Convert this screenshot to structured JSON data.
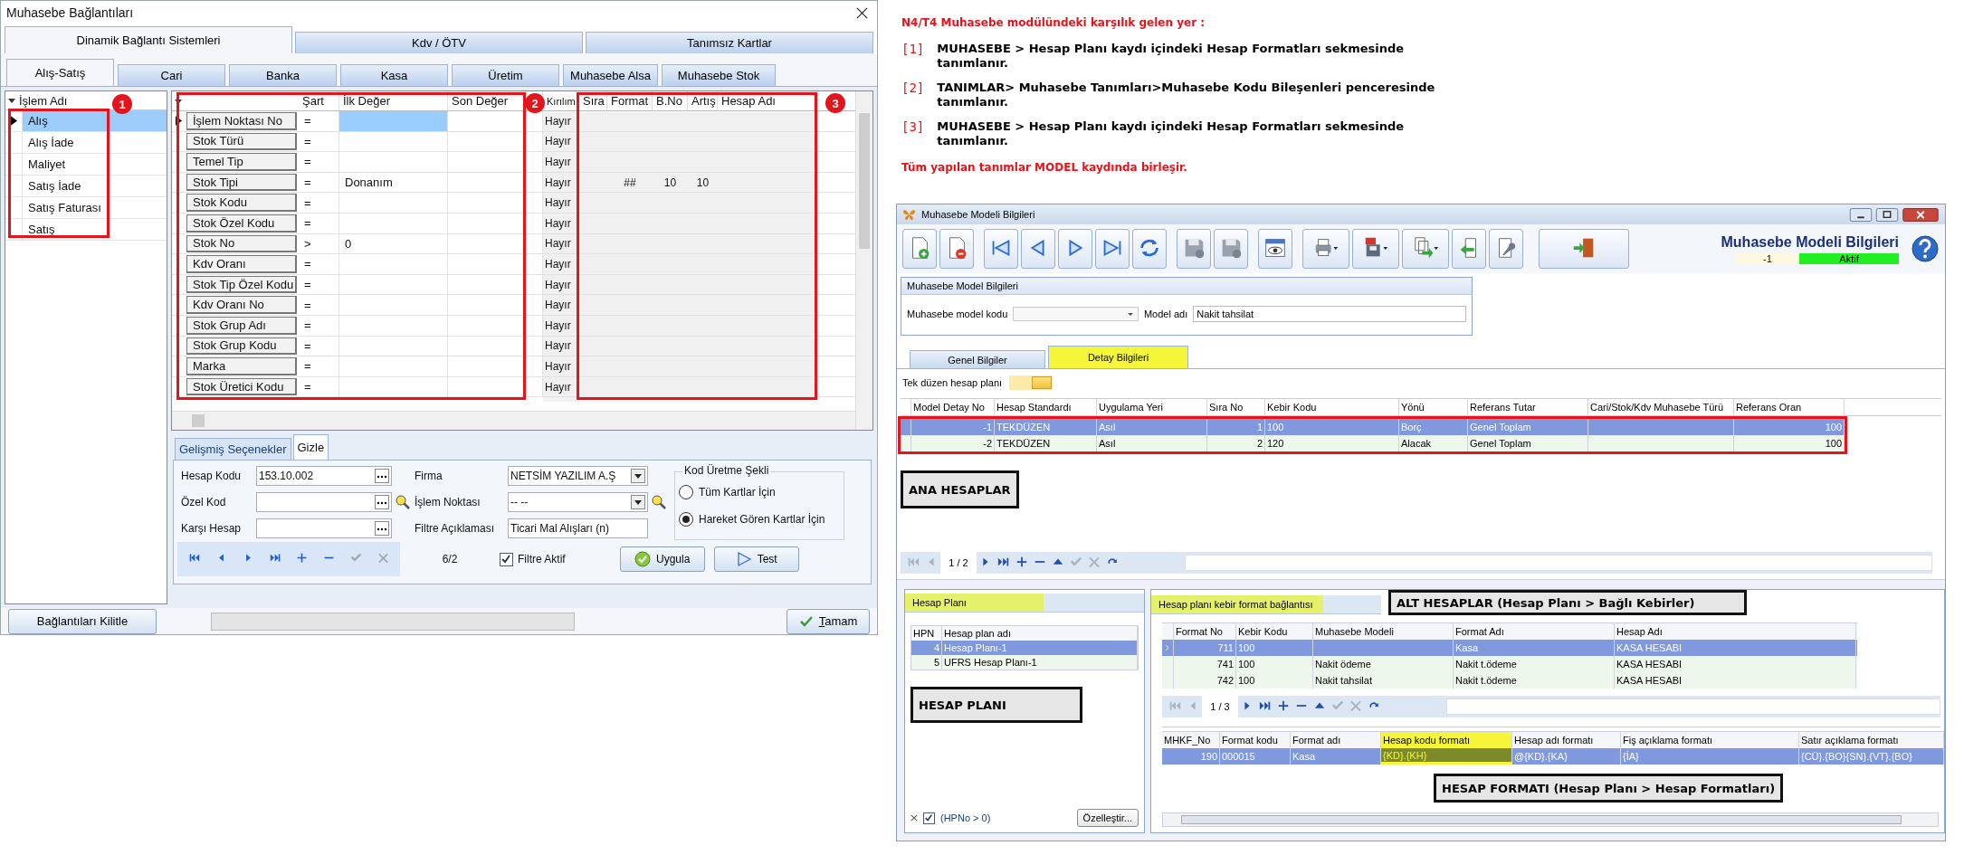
{
  "left_window": {
    "title": "Muhasebe Bağlantıları",
    "top_tabs": [
      {
        "label": "Dinamik Bağlantı Sistemleri",
        "selected": true
      },
      {
        "label": "Kdv / ÖTV",
        "selected": false
      },
      {
        "label": "Tanımsız Kartlar",
        "selected": false
      }
    ],
    "sub_tabs": [
      {
        "label": "Alış-Satış",
        "selected": true
      },
      {
        "label": "Cari",
        "selected": false
      },
      {
        "label": "Banka",
        "selected": false
      },
      {
        "label": "Kasa",
        "selected": false
      },
      {
        "label": "Üretim",
        "selected": false
      },
      {
        "label": "Muhasebe Alsa",
        "selected": false
      },
      {
        "label": "Muhasebe Stok",
        "selected": false
      }
    ],
    "process_list": {
      "header": "İşlem Adı",
      "marker": "1",
      "items": [
        {
          "label": "Alış",
          "selected": true
        },
        {
          "label": "Alış İade",
          "selected": false
        },
        {
          "label": "Maliyet",
          "selected": false
        },
        {
          "label": "Satış İade",
          "selected": false
        },
        {
          "label": "Satış Faturası",
          "selected": false
        },
        {
          "label": "Satış",
          "selected": false
        }
      ]
    },
    "grid": {
      "columns": [
        "Şart",
        "İlk Değer",
        "Son Değer",
        "Kırılım",
        "Sıra",
        "Format",
        "B.No",
        "Artış",
        "Hesap Adı"
      ],
      "markers": [
        "2",
        "3"
      ],
      "rows": [
        {
          "field": "İşlem Noktası No",
          "condition": "=",
          "breakdown": "Hayır",
          "selected": true
        },
        {
          "field": "Stok Türü",
          "condition": "=",
          "breakdown": "Hayır",
          "selected": false
        },
        {
          "field": "Temel Tip",
          "condition": "=",
          "breakdown": "Hayır",
          "selected": false
        },
        {
          "field": "Stok Tipi",
          "condition": "=",
          "start_value": "Donanım",
          "breakdown": "Hayır",
          "format": "##",
          "digit_no": "10",
          "increment": "10",
          "selected": false
        },
        {
          "field": "Stok Kodu",
          "condition": "=",
          "breakdown": "Hayır",
          "selected": false
        },
        {
          "field": "Stok Özel Kodu",
          "condition": "=",
          "breakdown": "Hayır",
          "selected": false
        },
        {
          "field": "Stok No",
          "condition": ">",
          "start_value": "0",
          "breakdown": "Hayır",
          "selected": false
        },
        {
          "field": "Kdv Oranı",
          "condition": "=",
          "breakdown": "Hayır",
          "selected": false
        },
        {
          "field": "Stok Tip Özel Kodu",
          "condition": "=",
          "breakdown": "Hayır",
          "selected": false
        },
        {
          "field": "Kdv Oranı No",
          "condition": "=",
          "breakdown": "Hayır",
          "selected": false
        },
        {
          "field": "Stok Grup Adı",
          "condition": "=",
          "breakdown": "Hayır",
          "selected": false
        },
        {
          "field": "Stok Grup Kodu",
          "condition": "=",
          "breakdown": "Hayır",
          "selected": false
        },
        {
          "field": "Marka",
          "condition": "=",
          "breakdown": "Hayır",
          "selected": false
        },
        {
          "field": "Stok Üretici Kodu",
          "condition": "=",
          "breakdown": "Hayır",
          "selected": false
        }
      ]
    },
    "option_tabs": [
      {
        "label": "Gelişmiş Seçenekler",
        "selected": false
      },
      {
        "label": "Gizle",
        "selected": true
      }
    ],
    "fields_left": [
      {
        "label": "Hesap Kodu",
        "value": "153.10.002",
        "kind": "lookup"
      },
      {
        "label": "Özel Kod",
        "kind": "lookup_search"
      },
      {
        "label": "Karşı Hesap",
        "kind": "lookup"
      }
    ],
    "fields_right": [
      {
        "label": "Firma",
        "value": "NETSİM YAZILIM A.Ş",
        "kind": "dropdown"
      },
      {
        "label": "İşlem Noktası",
        "value": "-- --",
        "kind": "dropdown_search"
      },
      {
        "label": "Filtre Açıklaması",
        "value": "Ticari Mal Alışları (n)",
        "kind": "text"
      }
    ],
    "code_generation": {
      "title": "Kod Üretme Şekli",
      "options": [
        {
          "label": "Tüm Kartlar İçin",
          "selected": false
        },
        {
          "label": "Hareket Gören Kartlar İçin",
          "selected": true
        }
      ]
    },
    "navigator": {
      "buttons": [
        {
          "kind": "first",
          "disabled": false
        },
        {
          "kind": "prev",
          "disabled": false
        },
        {
          "kind": "next",
          "disabled": false
        },
        {
          "kind": "last",
          "disabled": false
        },
        {
          "kind": "add",
          "disabled": false
        },
        {
          "kind": "remove",
          "disabled": false
        },
        {
          "kind": "confirm",
          "disabled": true
        },
        {
          "kind": "cancel",
          "disabled": true
        }
      ],
      "counter": "6/2"
    },
    "filter_active": {
      "label": "Filtre Aktif",
      "checked": true
    },
    "actions": [
      {
        "label": "Uygula",
        "kind": "apply"
      },
      {
        "label": "Test",
        "kind": "test"
      }
    ],
    "lock_button": "Bağlantıları Kilitle",
    "progress": {
      "level": 0
    },
    "ok_button": "Tamam"
  },
  "notes": {
    "heading": "N4/T4 Muhasebe modülündeki karşılık gelen yer :",
    "items": [
      {
        "marker": "[1]",
        "text": "MUHASEBE > Hesap Planı kaydı içindeki Hesap Formatları sekmesinde tanımlanır."
      },
      {
        "marker": "[2]",
        "text": "TANIMLAR> Muhasebe Tanımları>Muhasebe Kodu Bileşenleri penceresinde tanımlanır."
      },
      {
        "marker": "[3]",
        "text": "MUHASEBE > Hesap Planı kaydı içindeki Hesap Formatları sekmesinde tanımlanır."
      }
    ],
    "summary": "Tüm yapılan tanımlar MODEL kaydında birleşir."
  },
  "model_window": {
    "title": "Muhasebe Modeli Bilgileri",
    "header": {
      "title": "Muhasebe Modeli Bilgileri",
      "record": "-1",
      "status": "Aktif"
    },
    "model_group": {
      "title": "Muhasebe Model Bilgileri",
      "code_label": "Muhasebe model kodu",
      "name_label": "Model adı",
      "name_value": "Nakit tahsilat"
    },
    "tabs": [
      {
        "label": "Genel Bilgiler",
        "selected": false
      },
      {
        "label": "Detay Bilgileri",
        "selected": true
      }
    ],
    "single_plan_label": "Tek düzen hesap planı",
    "detail_grid": {
      "columns": [
        "Model Detay No",
        "Hesap Standardı",
        "Uygulama Yeri",
        "Sıra No",
        "Kebir Kodu",
        "Yönü",
        "Referans Tutar",
        "Cari/Stok/Kdv Muhasebe Türü",
        "Referans Oran"
      ],
      "rows": [
        {
          "detail_no": "-1",
          "standard": "TEKDÜZEN",
          "application": "Asıl",
          "order": "1",
          "kebir": "100",
          "direction": "Borç",
          "reference_amount": "Genel Toplam",
          "reference_rate": "100",
          "selected": true
        },
        {
          "detail_no": "-2",
          "standard": "TEKDÜZEN",
          "application": "Asıl",
          "order": "2",
          "kebir": "120",
          "direction": "Alacak",
          "reference_amount": "Genel Toplam",
          "reference_rate": "100",
          "selected": false
        }
      ],
      "callout": "ANA HESAPLAR",
      "navigator": {
        "buttons": [
          {
            "kind": "first",
            "disabled": true
          },
          {
            "kind": "prev",
            "disabled": true
          },
          {
            "kind": "counter",
            "label": "1 / 2"
          },
          {
            "kind": "next",
            "disabled": false
          },
          {
            "kind": "last",
            "disabled": false
          },
          {
            "kind": "add",
            "disabled": false
          },
          {
            "kind": "remove",
            "disabled": false
          },
          {
            "kind": "up",
            "disabled": false
          },
          {
            "kind": "confirm",
            "disabled": true
          },
          {
            "kind": "cancel",
            "disabled": true
          },
          {
            "kind": "redo",
            "disabled": false
          }
        ]
      }
    },
    "plan_panel": {
      "title": "Hesap Planı",
      "columns": [
        "HPN",
        "Hesap plan adı"
      ],
      "rows": [
        {
          "no": "4",
          "name": "Hesap Planı-1",
          "selected": true
        },
        {
          "no": "5",
          "name": "UFRS Hesap Planı-1",
          "selected": false
        }
      ],
      "callout": "HESAP PLANI",
      "filter": {
        "text": "(HPNo > 0)",
        "checked": true
      },
      "customize_button": "Özelleştir..."
    },
    "kebir_panel": {
      "title": "Hesap planı kebir format bağlantısı",
      "callout": "ALT HESAPLAR (Hesap Planı > Bağlı Kebirler)",
      "columns": [
        "Format No",
        "Kebir Kodu",
        "Muhasebe Modeli",
        "Format Adı",
        "Hesap Adı"
      ],
      "rows": [
        {
          "format_no": "711",
          "kebir": "100",
          "format_name": "Kasa",
          "account": "KASA HESABI",
          "selected": true
        },
        {
          "format_no": "741",
          "kebir": "100",
          "model": "Nakit ödeme",
          "format_name": "Nakit t.ödeme",
          "account": "KASA HESABI",
          "selected": false
        },
        {
          "format_no": "742",
          "kebir": "100",
          "model": "Nakit tahsilat",
          "format_name": "Nakit t.ödeme",
          "account": "KASA HESABI",
          "selected": false
        }
      ],
      "navigator": {
        "buttons": [
          {
            "kind": "first",
            "disabled": true
          },
          {
            "kind": "prev",
            "disabled": true
          },
          {
            "kind": "counter",
            "label": "1 / 3"
          },
          {
            "kind": "next",
            "disabled": false
          },
          {
            "kind": "last",
            "disabled": false
          },
          {
            "kind": "add",
            "disabled": false
          },
          {
            "kind": "remove",
            "disabled": false
          },
          {
            "kind": "up",
            "disabled": false
          },
          {
            "kind": "confirm",
            "disabled": true
          },
          {
            "kind": "cancel",
            "disabled": true
          },
          {
            "kind": "redo",
            "disabled": false
          }
        ]
      },
      "format_grid": {
        "columns": [
          {
            "label": "MHKF_No",
            "highlighted": false
          },
          {
            "label": "Format kodu",
            "highlighted": false
          },
          {
            "label": "Format adı",
            "highlighted": false
          },
          {
            "label": "Hesap kodu formatı",
            "highlighted": true
          },
          {
            "label": "Hesap adı formatı",
            "highlighted": false
          },
          {
            "label": "Fiş açıklama formatı",
            "highlighted": false
          },
          {
            "label": "Satır açıklama formatı",
            "highlighted": false
          }
        ],
        "rows": [
          {
            "mhkf_no": "190",
            "format_code": "000015",
            "format_name": "Kasa",
            "code_format": "{KD}.{KH}",
            "name_format": "@{KD}.{KA}",
            "slip_format": "{İA}",
            "line_format": "{CÜ}.{BO}{SN}.{VT}.{BO}",
            "selected": true
          }
        ]
      },
      "format_callout": "HESAP FORMATI (Hesap Planı > Hesap Formatları)"
    }
  }
}
